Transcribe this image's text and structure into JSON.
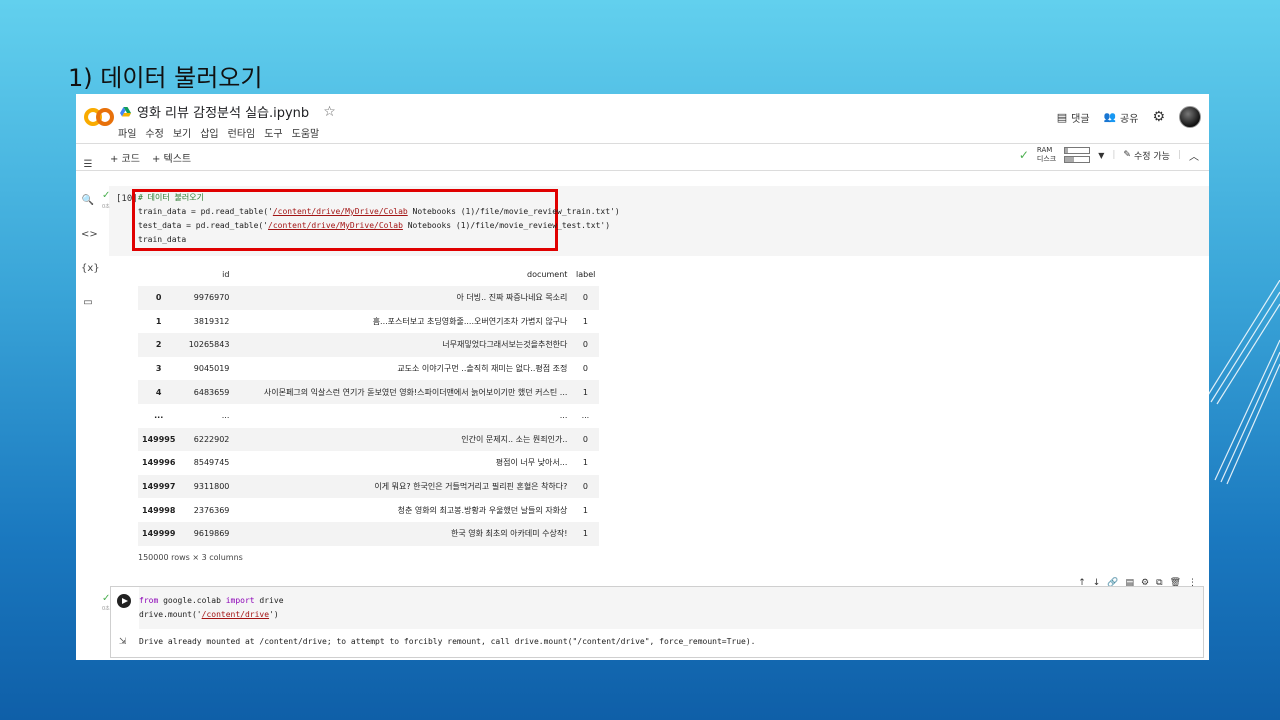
{
  "slide": {
    "title": "1) 데이터 불러오기"
  },
  "colab": {
    "logo": "CO",
    "file_name": "영화 리뷰 감정분석 실습.ipynb",
    "star_icon": "star-icon",
    "menu": [
      "파일",
      "수정",
      "보기",
      "삽입",
      "런타임",
      "도구",
      "도움말"
    ],
    "header_right": {
      "comment": "댓글",
      "share": "공유"
    },
    "toolbar": {
      "add_code": "+ 코드",
      "add_text": "+ 텍스트",
      "ram": "RAM",
      "disk": "디스크",
      "edit_mode": "수정 가능"
    },
    "ram_usage": 0.1,
    "disk_usage": 0.35
  },
  "cell1": {
    "exec_count": "[10]",
    "status_small": "0초",
    "code": {
      "comment": "# 데이터 불러오기",
      "line1_pre": "train_data = pd.read_table('",
      "line1_str": "/content/drive/MyDrive/Colab",
      "line1_post": " Notebooks (1)/file/movie_review_train.txt')",
      "line2_pre": "test_data = pd.read_table('",
      "line2_str": "/content/drive/MyDrive/Colab",
      "line2_post": " Notebooks (1)/file/movie_review_test.txt')",
      "line3": "train_data"
    }
  },
  "table": {
    "columns": [
      "",
      "id",
      "document",
      "label"
    ],
    "rows": [
      [
        "0",
        "9976970",
        "아 더빙.. 진짜 짜증나네요 목소리",
        "0"
      ],
      [
        "1",
        "3819312",
        "흠...포스터보고 초딩영화줄....오버연기조차 가볍지 않구나",
        "1"
      ],
      [
        "2",
        "10265843",
        "너무재밓었다그래서보는것을추천한다",
        "0"
      ],
      [
        "3",
        "9045019",
        "교도소 이야기구먼 ..솔직히 재미는 없다..평점 조정",
        "0"
      ],
      [
        "4",
        "6483659",
        "사이몬페그의 익살스런 연기가 돋보였던 영화!스파이더맨에서 늙어보이기만 했던 커스틴 ...",
        "1"
      ],
      [
        "...",
        "...",
        "...",
        "..."
      ],
      [
        "149995",
        "6222902",
        "인간이 문제지.. 소는 뭔죄인가..",
        "0"
      ],
      [
        "149996",
        "8549745",
        "평점이 너무 낮아서...",
        "1"
      ],
      [
        "149997",
        "9311800",
        "이게 뭐요? 한국인은 거들먹거리고 필리핀 혼혈은 착하다?",
        "0"
      ],
      [
        "149998",
        "2376369",
        "청춘 영화의 최고봉.방황과 우울했던 날들의 자화상",
        "1"
      ],
      [
        "149999",
        "9619869",
        "한국 영화 최초의 아카데미 수상작!",
        "1"
      ]
    ],
    "shape": "150000 rows × 3 columns"
  },
  "cell2": {
    "status_small": "0초",
    "code_kw1": "from",
    "code_mod": " google.colab ",
    "code_kw2": "import",
    "code_name": " drive",
    "line2_pre": "drive.mount('",
    "line2_str": "/content/drive",
    "line2_post": "')",
    "output": "Drive already mounted at /content/drive; to attempt to forcibly remount, call drive.mount(\"/content/drive\", force_remount=True)."
  }
}
